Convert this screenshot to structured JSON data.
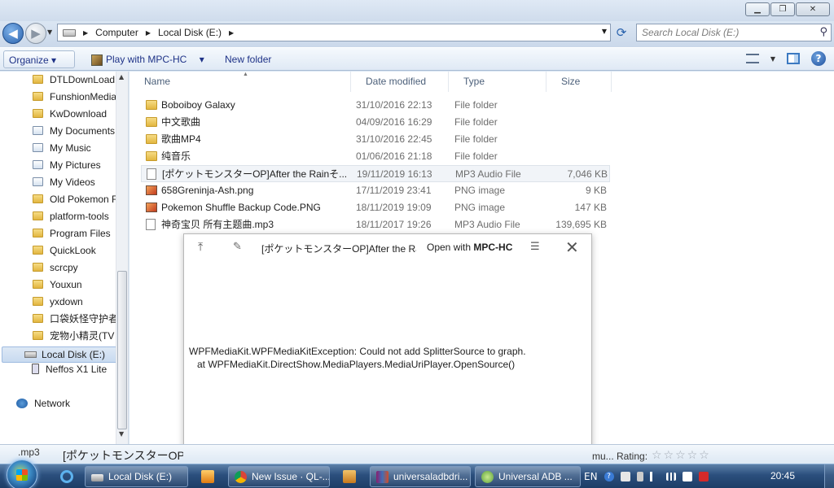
{
  "window": {
    "minimize_glyph": "▁",
    "maximize_glyph": "❐",
    "close_glyph": "✕"
  },
  "nav": {
    "back_glyph": "◀",
    "forward_glyph": "▶",
    "breadcrumb": [
      "Computer",
      "Local Disk (E:)"
    ],
    "search_placeholder": "Search Local Disk (E:)"
  },
  "toolbar": {
    "organize": "Organize ▾",
    "play_with": "Play with MPC-HC",
    "play_dropdown": "▾",
    "new_folder": "New folder"
  },
  "sidebar": {
    "folders": [
      {
        "label": "DTLDownLoad",
        "icon": "folder-icon"
      },
      {
        "label": "FunshionMedia",
        "icon": "folder-icon"
      },
      {
        "label": "KwDownload",
        "icon": "folder-icon"
      },
      {
        "label": "My Documents",
        "icon": "library-icon"
      },
      {
        "label": "My Music",
        "icon": "library-icon"
      },
      {
        "label": "My Pictures",
        "icon": "library-icon"
      },
      {
        "label": "My Videos",
        "icon": "library-icon"
      },
      {
        "label": "Old Pokemon F",
        "icon": "folder-icon"
      },
      {
        "label": "platform-tools",
        "icon": "folder-icon"
      },
      {
        "label": "Program Files",
        "icon": "folder-icon"
      },
      {
        "label": "QuickLook",
        "icon": "folder-icon"
      },
      {
        "label": "scrcpy",
        "icon": "folder-icon"
      },
      {
        "label": "Youxun",
        "icon": "folder-icon"
      },
      {
        "label": "yxdown",
        "icon": "folder-icon"
      },
      {
        "label": "口袋妖怪守护者",
        "icon": "folder-icon"
      },
      {
        "label": "宠物小精灵(TV",
        "icon": "folder-icon"
      }
    ],
    "local_disk": "Local Disk (E:)",
    "device": "Neffos X1 Lite",
    "network": "Network"
  },
  "columns": {
    "name": "Name",
    "date": "Date modified",
    "type": "Type",
    "size": "Size"
  },
  "files": [
    {
      "name": "Boboiboy Galaxy",
      "date": "31/10/2016 22:13",
      "type": "File folder",
      "size": "",
      "kind": "folder"
    },
    {
      "name": "中文歌曲",
      "date": "04/09/2016 16:29",
      "type": "File folder",
      "size": "",
      "kind": "folder"
    },
    {
      "name": "歌曲MP4",
      "date": "31/10/2016 22:45",
      "type": "File folder",
      "size": "",
      "kind": "folder"
    },
    {
      "name": "纯音乐",
      "date": "01/06/2016 21:18",
      "type": "File folder",
      "size": "",
      "kind": "folder"
    },
    {
      "name": "[ポケットモンスターOP]After the Rainそ...",
      "date": "19/11/2019 16:13",
      "type": "MP3 Audio File",
      "size": "7,046 KB",
      "kind": "mp3",
      "selected": true
    },
    {
      "name": "658Greninja-Ash.png",
      "date": "17/11/2019 23:41",
      "type": "PNG image",
      "size": "9 KB",
      "kind": "png"
    },
    {
      "name": "Pokemon Shuffle Backup Code.PNG",
      "date": "18/11/2019 19:09",
      "type": "PNG image",
      "size": "147 KB",
      "kind": "png"
    },
    {
      "name": "神奇宝贝 所有主题曲.mp3",
      "date": "18/11/2017 19:26",
      "type": "MP3 Audio File",
      "size": "139,695 KB",
      "kind": "mp3"
    }
  ],
  "quicklook": {
    "title": "[ポケットモンスターOP]After the Rain...",
    "open_with_prefix": "Open with ",
    "open_with_app": "MPC-HC",
    "error_line1": "WPFMediaKit.WPFMediaKitException: Could not add SplitterSource to graph.",
    "error_line2": "   at WPFMediaKit.DirectShow.MediaPlayers.MediaUriPlayer.OpenSource()"
  },
  "details": {
    "type_label": ".mp3",
    "name": "[ポケットモンスターOP]After the Rainそ",
    "rating_label": "mu... Rating:",
    "stars": "☆☆☆☆☆"
  },
  "taskbar": {
    "tasks": [
      {
        "label": "Local Disk (E:)",
        "icon": "explorer-icon"
      },
      {
        "label": "New Issue · QL-...",
        "icon": "chrome-icon"
      },
      {
        "label": "universaladbdri...",
        "icon": "winrar-icon"
      },
      {
        "label": "Universal ADB ...",
        "icon": "installer-icon"
      }
    ],
    "language": "EN",
    "time": "20:45"
  },
  "colors": {
    "accent": "#2a62ad",
    "selection": "#f1f4f8",
    "folder": "#e2b640"
  }
}
